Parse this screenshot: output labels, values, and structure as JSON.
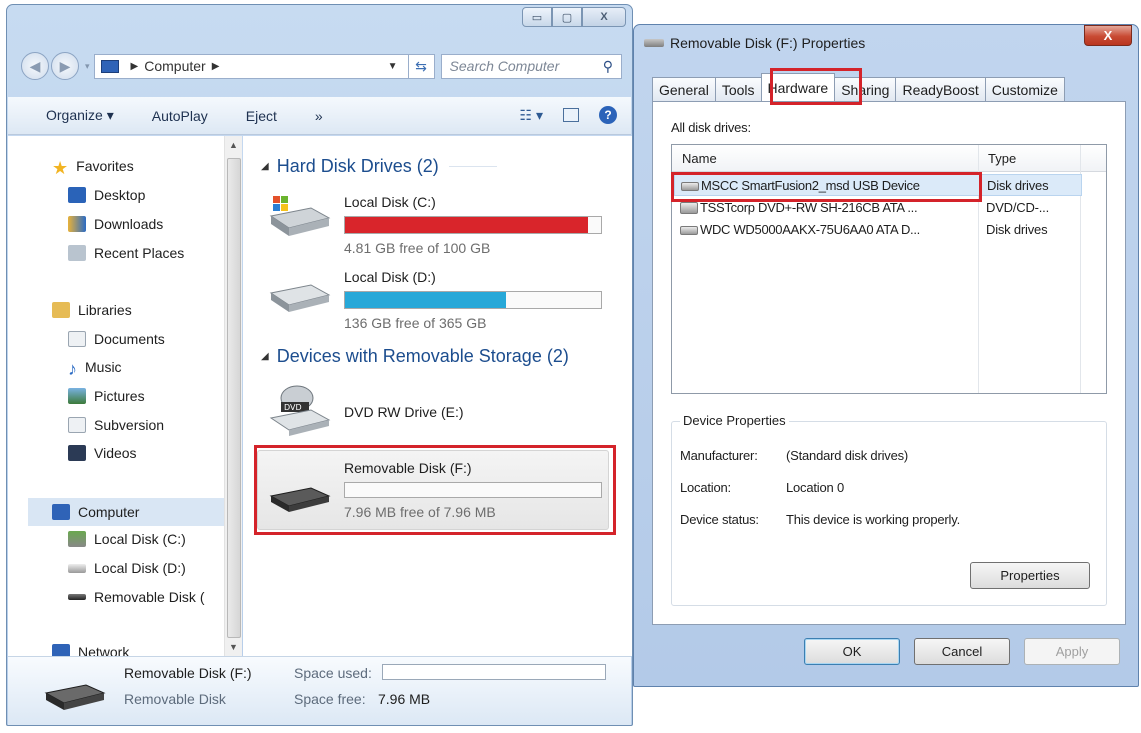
{
  "explorer": {
    "window_controls": [
      "▭",
      "▢",
      "X"
    ],
    "address": {
      "root": "Computer"
    },
    "search_placeholder": "Search Computer",
    "toolbar": {
      "organize": "Organize ▾",
      "autoplay": "AutoPlay",
      "eject": "Eject",
      "more": "»"
    },
    "nav": {
      "favorites": "Favorites",
      "desktop": "Desktop",
      "downloads": "Downloads",
      "recent": "Recent Places",
      "libraries": "Libraries",
      "documents": "Documents",
      "music": "Music",
      "pictures": "Pictures",
      "subversion": "Subversion",
      "videos": "Videos",
      "computer": "Computer",
      "local_c": "Local Disk (C:)",
      "local_d": "Local Disk (D:)",
      "removable": "Removable Disk (",
      "network": "Network"
    },
    "groups": {
      "hard_disks": "Hard Disk Drives (2)",
      "removable": "Devices with Removable Storage (2)"
    },
    "drives": [
      {
        "name": "Local Disk (C:)",
        "free_text": "4.81 GB free of 100 GB",
        "used_fraction": 0.95,
        "bar_color": "#d9252b"
      },
      {
        "name": "Local Disk (D:)",
        "free_text": "136 GB free of 365 GB",
        "used_fraction": 0.63,
        "bar_color": "#27a8d8"
      },
      {
        "name": "DVD RW Drive (E:)"
      },
      {
        "name": "Removable Disk (F:)",
        "free_text": "7.96 MB free of 7.96 MB",
        "used_fraction": 0.0
      }
    ],
    "details": {
      "name": "Removable Disk (F:)",
      "type": "Removable Disk",
      "space_used_label": "Space used:",
      "space_free_label": "Space free:",
      "space_free_value": "7.96 MB"
    }
  },
  "dialog": {
    "title": "Removable Disk (F:) Properties",
    "close": "X",
    "tabs": [
      "General",
      "Tools",
      "Hardware",
      "Sharing",
      "ReadyBoost",
      "Customize"
    ],
    "active_tab": "Hardware",
    "all_drives_label": "All disk drives:",
    "columns": [
      "Name",
      "Type"
    ],
    "rows": [
      {
        "name": "MSCC SmartFusion2_msd USB Device",
        "type": "Disk drives"
      },
      {
        "name": "TSSTcorp DVD+-RW SH-216CB ATA ...",
        "type": "DVD/CD-..."
      },
      {
        "name": "WDC WD5000AAKX-75U6AA0 ATA D...",
        "type": "Disk drives"
      }
    ],
    "device_props": {
      "title": "Device Properties",
      "manufacturer_label": "Manufacturer:",
      "manufacturer": "(Standard disk drives)",
      "location_label": "Location:",
      "location": "Location 0",
      "status_label": "Device status:",
      "status": "This device is working properly.",
      "properties_btn": "Properties"
    },
    "buttons": {
      "ok": "OK",
      "cancel": "Cancel",
      "apply": "Apply"
    }
  },
  "colors": {
    "highlight": "#d4232a",
    "accent": "#1c4d8e"
  }
}
